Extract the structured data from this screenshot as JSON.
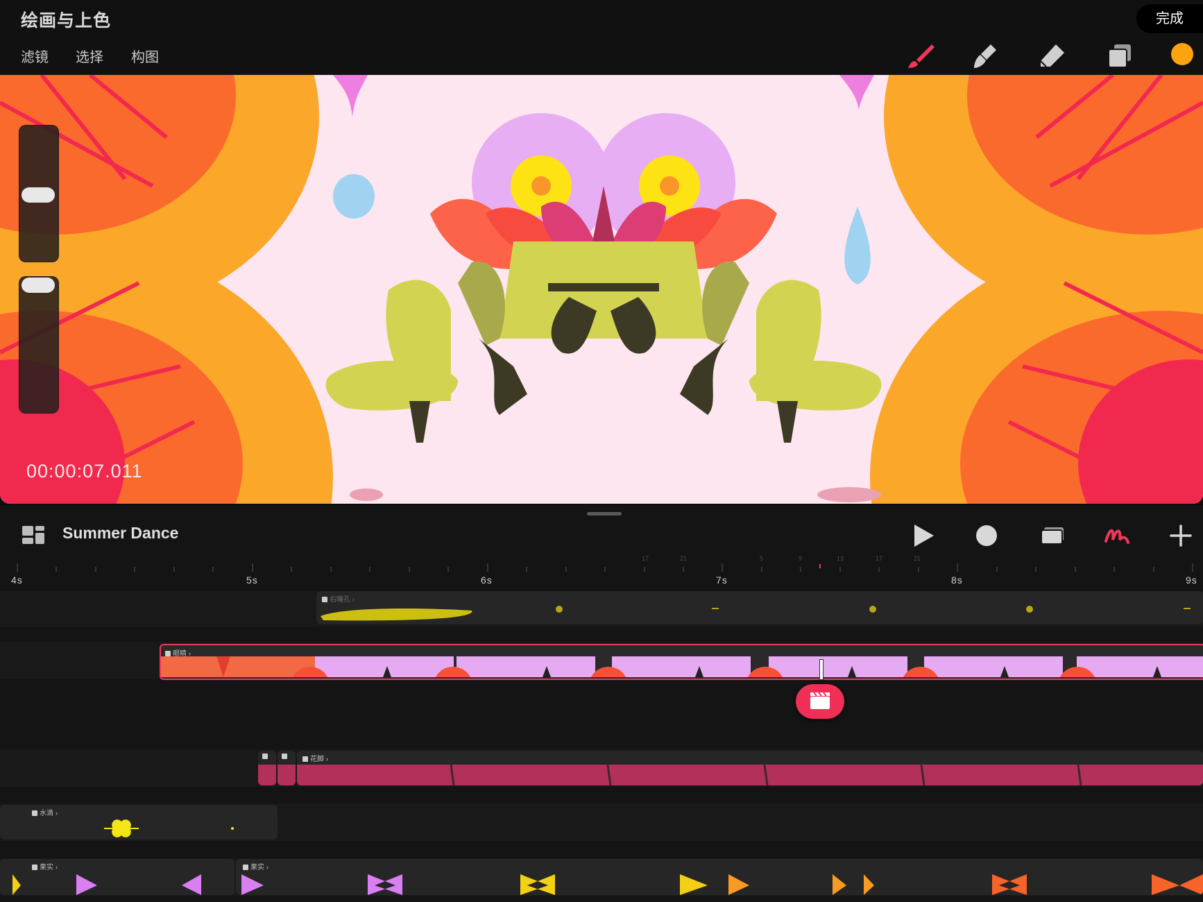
{
  "header": {
    "app_title": "绘画与上色",
    "done_label": "完成",
    "menu": [
      "滤镜",
      "选择",
      "构图"
    ],
    "tools": [
      "brush-icon",
      "smudge-icon",
      "eraser-icon",
      "layers-icon",
      "color-swatch"
    ],
    "accent_color": "#f0385a",
    "current_color": "#fca311"
  },
  "canvas": {
    "timecode": "00:00:07.011",
    "brush_size_level": 0.45,
    "opacity_level": 0.9
  },
  "timeline": {
    "project_title": "Summer Dance",
    "controls": [
      "play-icon",
      "record-icon",
      "onion-skin-icon",
      "animation-assist-icon",
      "add-icon"
    ],
    "ruler_labels": [
      "4s",
      "5s",
      "6s",
      "7s",
      "8s",
      "9s"
    ],
    "frame_ticks": [
      "17",
      "21",
      "5",
      "9",
      "13",
      "17",
      "21"
    ],
    "tracks": [
      {
        "label": "右瞳孔"
      },
      {
        "label": "眼睛"
      },
      {
        "label": "花脚"
      },
      {
        "label": "水滴"
      },
      {
        "label": "果实"
      },
      {
        "label": "果实"
      }
    ]
  }
}
